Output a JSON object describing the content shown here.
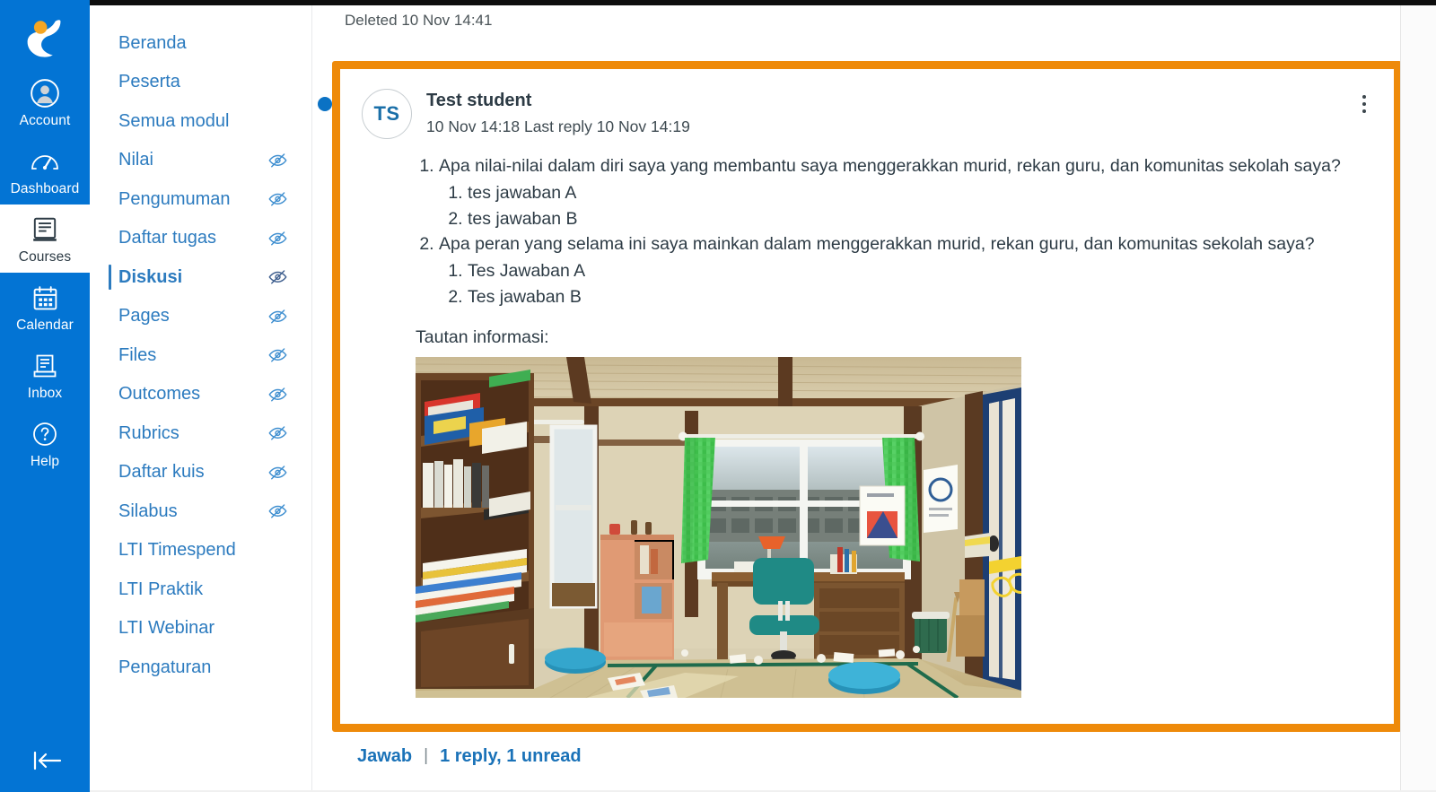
{
  "global_nav": {
    "brand": {
      "icon": "instructure-bird-logo",
      "alt": "Canvas logo"
    },
    "items": [
      {
        "label": "Account",
        "icon": "user-avatar-icon",
        "active": false
      },
      {
        "label": "Dashboard",
        "icon": "dashboard-gauge-icon",
        "active": false
      },
      {
        "label": "Courses",
        "icon": "courses-book-icon",
        "active": true
      },
      {
        "label": "Calendar",
        "icon": "calendar-icon",
        "active": false
      },
      {
        "label": "Inbox",
        "icon": "inbox-tray-icon",
        "active": false
      },
      {
        "label": "Help",
        "icon": "help-question-icon",
        "active": false
      }
    ],
    "collapse": {
      "label": "",
      "icon": "collapse-arrow-left-icon"
    }
  },
  "course_nav": {
    "items": [
      {
        "label": "Beranda",
        "hidden_icon": false,
        "active": false
      },
      {
        "label": "Peserta",
        "hidden_icon": false,
        "active": false
      },
      {
        "label": "Semua modul",
        "hidden_icon": false,
        "active": false
      },
      {
        "label": "Nilai",
        "hidden_icon": true,
        "active": false
      },
      {
        "label": "Pengumuman",
        "hidden_icon": true,
        "active": false
      },
      {
        "label": "Daftar tugas",
        "hidden_icon": true,
        "active": false
      },
      {
        "label": "Diskusi",
        "hidden_icon": true,
        "active": true
      },
      {
        "label": "Pages",
        "hidden_icon": true,
        "active": false
      },
      {
        "label": "Files",
        "hidden_icon": true,
        "active": false
      },
      {
        "label": "Outcomes",
        "hidden_icon": true,
        "active": false
      },
      {
        "label": "Rubrics",
        "hidden_icon": true,
        "active": false
      },
      {
        "label": "Daftar kuis",
        "hidden_icon": true,
        "active": false
      },
      {
        "label": "Silabus",
        "hidden_icon": true,
        "active": false
      },
      {
        "label": "LTI Timespend",
        "hidden_icon": false,
        "active": false
      },
      {
        "label": "LTI Praktik",
        "hidden_icon": false,
        "active": false
      },
      {
        "label": "LTI Webinar",
        "hidden_icon": false,
        "active": false
      },
      {
        "label": "Pengaturan",
        "hidden_icon": false,
        "active": false
      }
    ]
  },
  "main": {
    "deleted_note": "Deleted 10 Nov 14:41",
    "entry": {
      "avatar_initials": "TS",
      "author": "Test student",
      "meta": "10 Nov 14:18  Last reply 10 Nov 14:19",
      "kebab_icon": "more-options-kebab-icon",
      "unread_indicator": "unread-dot",
      "body": {
        "items": [
          {
            "text": "Apa nilai-nilai dalam diri saya yang membantu saya menggerakkan murid, rekan guru, dan komunitas sekolah saya?",
            "sub": [
              "tes jawaban A",
              "tes jawaban B"
            ]
          },
          {
            "text": "Apa peran yang selama ini saya mainkan dalam menggerakkan murid, rekan guru, dan komunitas sekolah saya?",
            "sub": [
              "Tes Jawaban A",
              "Tes jawaban B"
            ]
          }
        ],
        "caption": "Tautan informasi:",
        "image_alt": "anime-style-japanese-bedroom-illustration"
      },
      "footer": {
        "reply_label": "Jawab",
        "separator": "|",
        "reply_count": "1 reply, 1 unread"
      }
    }
  },
  "colors": {
    "brand_blue": "#0374D4",
    "link_blue": "#2C7BBF",
    "highlight_orange": "#EE8A0A",
    "text_dark": "#2D3B45",
    "unread_dot": "#0b72c4"
  }
}
